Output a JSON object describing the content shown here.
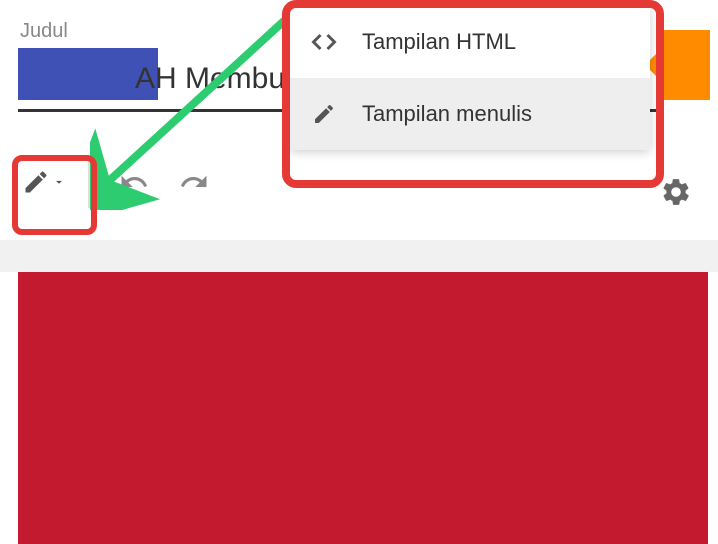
{
  "title": {
    "label": "Judul",
    "text": "AH Membuat"
  },
  "dropdown": {
    "items": [
      {
        "icon": "code",
        "label": "Tampilan HTML"
      },
      {
        "icon": "pencil",
        "label": "Tampilan menulis"
      }
    ]
  },
  "colors": {
    "accent": "#3f51b5",
    "content": "#c31a2f",
    "annotation_red": "#e53935",
    "annotation_green": "#2ecc71",
    "orange": "#ff8c00"
  }
}
